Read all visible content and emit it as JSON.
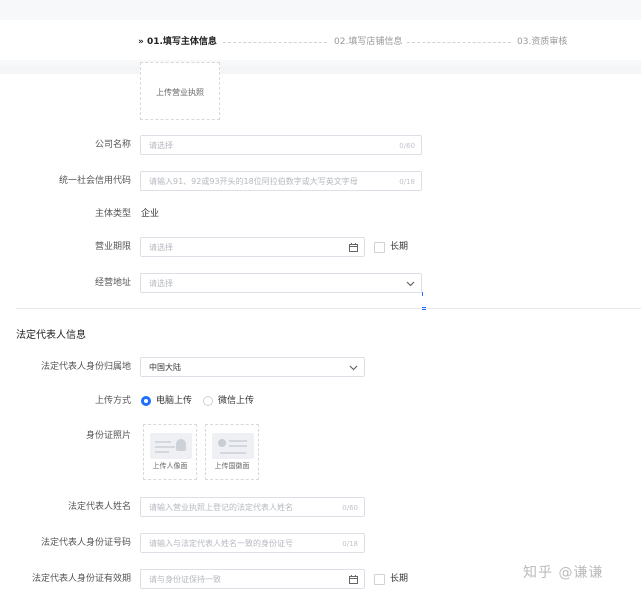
{
  "steps": [
    {
      "label": "» 01.填写主体信息",
      "active": true
    },
    {
      "label": "02.填写店铺信息",
      "active": false
    },
    {
      "label": "03.资质审核",
      "active": false
    }
  ],
  "license_upload": {
    "label": "上传营业执照"
  },
  "fields": {
    "company_name": {
      "label": "公司名称",
      "placeholder": "请选择",
      "counter": "0/60"
    },
    "credit_code": {
      "label": "统一社会信用代码",
      "placeholder": "请输入91、92或93开头的18位阿拉伯数字或大写英文字母",
      "counter": "0/18"
    },
    "entity_type": {
      "label": "主体类型",
      "value": "企业"
    },
    "business_term": {
      "label": "营业期限",
      "placeholder": "请选择",
      "long_term": "长期"
    },
    "business_address": {
      "label": "经营地址",
      "placeholder": "请选择"
    }
  },
  "legal_section": {
    "title": "法定代表人信息",
    "region": {
      "label": "法定代表人身份归属地",
      "value": "中国大陆"
    },
    "upload_method": {
      "label": "上传方式",
      "options": [
        "电脑上传",
        "微信上传"
      ],
      "selected": "电脑上传"
    },
    "id_photo": {
      "label": "身份证照片",
      "front": "上传人像面",
      "back": "上传国徽面"
    },
    "name": {
      "label": "法定代表人姓名",
      "placeholder": "请输入营业执照上登记的法定代表人姓名",
      "counter": "0/60"
    },
    "id_number": {
      "label": "法定代表人身份证号码",
      "placeholder": "请输入与法定代表人姓名一致的身份证号",
      "counter": "0/18"
    },
    "id_validity": {
      "label": "法定代表人身份证有效期",
      "placeholder": "请与身份证保持一致",
      "long_term": "长期"
    }
  },
  "watermark": "知乎 @谦谦",
  "icons": {
    "calendar": "calendar-icon",
    "dropdown": "chevron-down-icon"
  },
  "colors": {
    "accent": "#1e6fff"
  }
}
